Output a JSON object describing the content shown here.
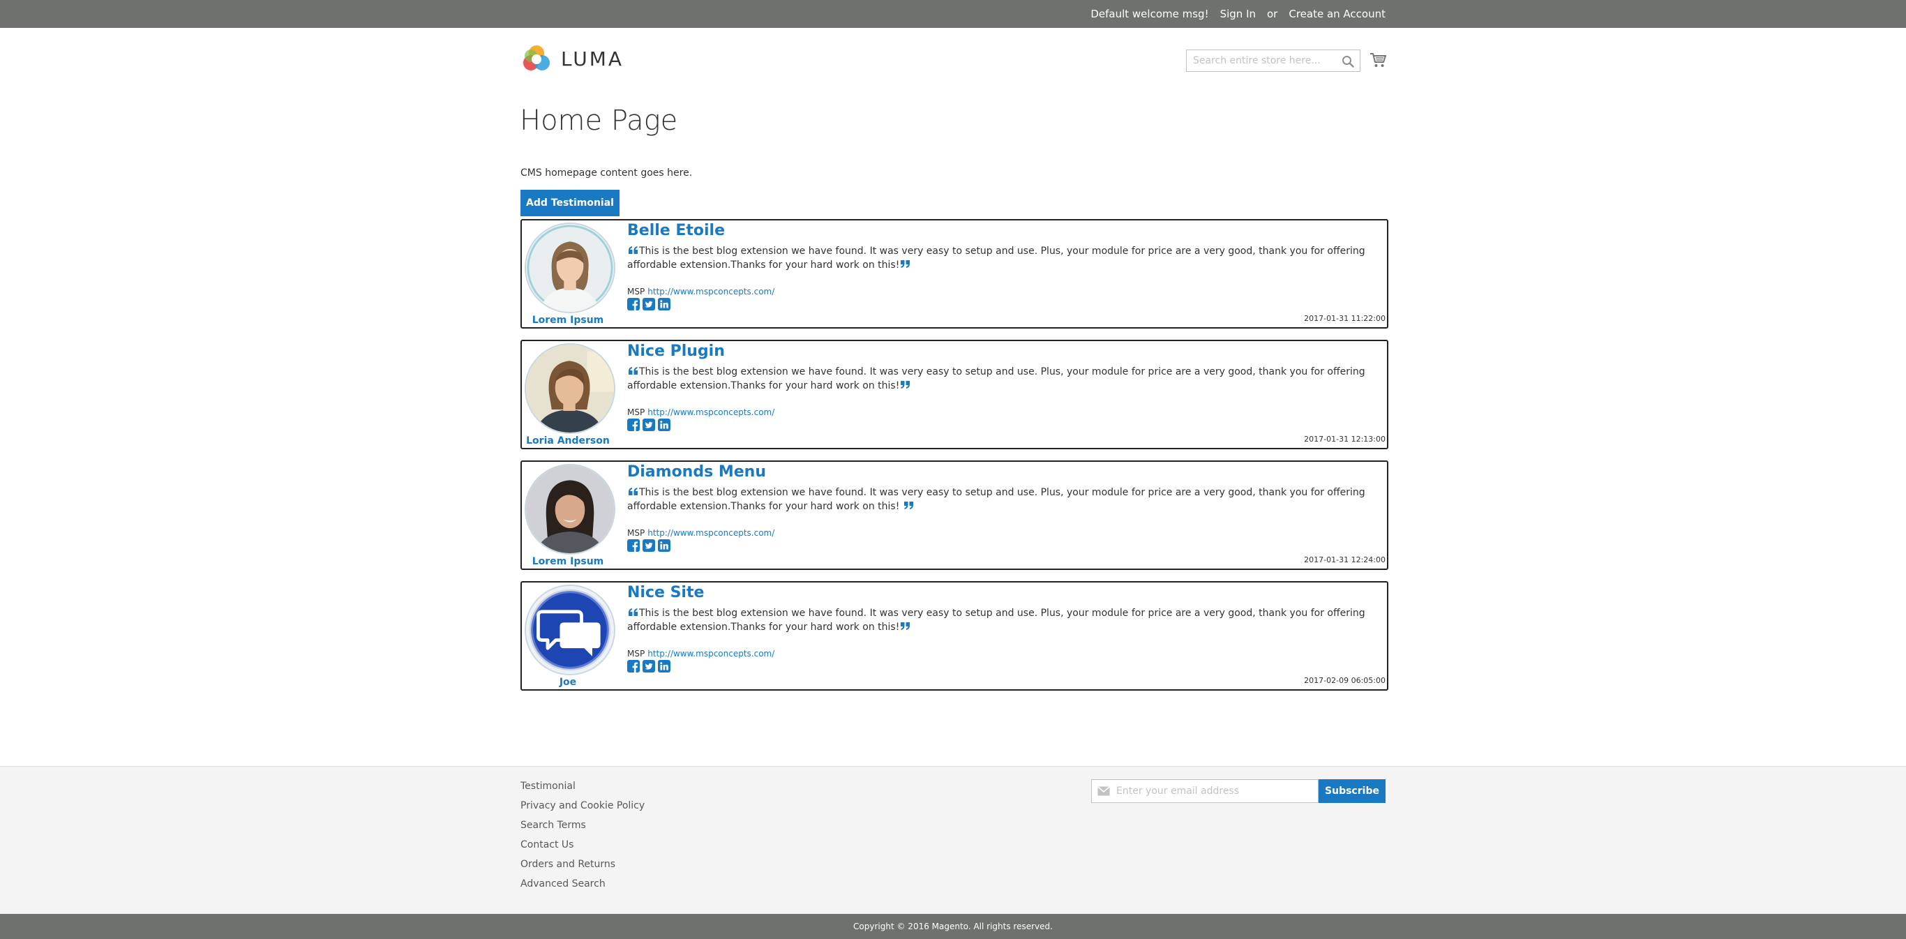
{
  "header": {
    "welcome": "Default welcome msg!",
    "sign_in": "Sign In",
    "or": "or",
    "create_account": "Create an Account",
    "logo_text": "LUMA",
    "search_placeholder": "Search entire store here..."
  },
  "main": {
    "page_title": "Home Page",
    "cms_text": "CMS homepage content goes here.",
    "add_button": "Add Testimonial"
  },
  "testimonials": [
    {
      "title": "Belle Etoile",
      "text": "This is the best blog extension we have found. It was very easy to setup and use. Plus, your module for price are a very good, thank you for offering affordable extension.Thanks for your hard work on this!",
      "company": "MSP",
      "url": "http://www.mspconcepts.com/",
      "author": "Lorem Ipsum",
      "date": "2017-01-31 11:22:00"
    },
    {
      "title": "Nice Plugin",
      "text": "This is the best blog extension we have found. It was very easy to setup and use. Plus, your module for price are a very good, thank you for offering affordable extension.Thanks for your hard work on this!",
      "company": "MSP",
      "url": "http://www.mspconcepts.com/",
      "author": "Loria Anderson",
      "date": "2017-01-31 12:13:00"
    },
    {
      "title": "Diamonds Menu",
      "text": "This is the best blog extension we have found. It was very easy to setup and use. Plus, your module for price are a very good, thank you for offering affordable extension.Thanks for your hard work on this! ",
      "company": "MSP",
      "url": "http://www.mspconcepts.com/",
      "author": "Lorem Ipsum",
      "date": "2017-01-31 12:24:00"
    },
    {
      "title": "Nice Site",
      "text": "This is the best blog extension we have found. It was very easy to setup and use. Plus, your module for price are a very good, thank you for offering affordable extension.Thanks for your hard work on this!",
      "company": "MSP",
      "url": "http://www.mspconcepts.com/",
      "author": "Joe",
      "date": "2017-02-09 06:05:00"
    }
  ],
  "footer": {
    "links": [
      "Testimonial",
      "Privacy and Cookie Policy",
      "Search Terms",
      "Contact Us",
      "Orders and Returns",
      "Advanced Search"
    ],
    "newsletter_placeholder": "Enter your email address",
    "subscribe": "Subscribe",
    "copyright": "Copyright © 2016 Magento. All rights reserved."
  },
  "colors": {
    "accent": "#1979c3",
    "top_bar": "#6e716e",
    "footer_bg": "#f4f4f4"
  },
  "icons": [
    "search-icon",
    "cart-icon",
    "quote-open-icon",
    "quote-close-icon",
    "facebook-icon",
    "twitter-icon",
    "linkedin-icon",
    "mail-icon"
  ]
}
